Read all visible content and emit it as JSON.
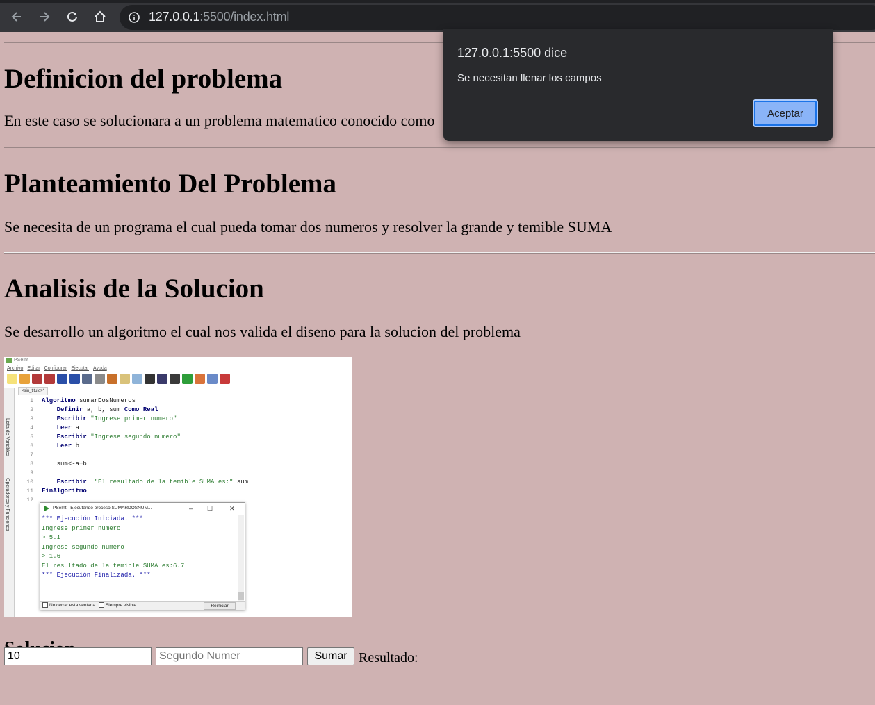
{
  "browser": {
    "url_host": "127.0.0.1",
    "url_rest": ":5500/index.html"
  },
  "sections": [
    {
      "title": "Definicion del problema",
      "text": "En este caso se solucionara a un problema matematico conocido como"
    },
    {
      "title": "Planteamiento Del Problema",
      "text": "Se necesita de un programa el cual pueda tomar dos numeros y resolver la grande y temible SUMA"
    },
    {
      "title": "Analisis de la Solucion",
      "text": "Se desarrollo un algoritmo el cual nos valida el diseno para la solucion del problema"
    }
  ],
  "pseint": {
    "title": "PSeInt",
    "menu": [
      "Archivo",
      "Editar",
      "Configurar",
      "Ejecutar",
      "Ayuda"
    ],
    "tab": "<sin_titulo>*",
    "side_labels": [
      "Lista de Variables",
      "Operadores y Funciones"
    ],
    "code": [
      {
        "n": "1",
        "kw": "Algoritmo",
        "rest": " sumarDosNumeros",
        "str": ""
      },
      {
        "n": "2",
        "kw": "    Definir",
        "rest": " a, b, sum ",
        "kw2": "Como Real",
        "str": ""
      },
      {
        "n": "3",
        "kw": "    Escribir",
        "rest": " ",
        "str": "\"Ingrese primer numero\""
      },
      {
        "n": "4",
        "kw": "    Leer",
        "rest": " a",
        "str": ""
      },
      {
        "n": "5",
        "kw": "    Escribir",
        "rest": " ",
        "str": "\"Ingrese segundo numero\""
      },
      {
        "n": "6",
        "kw": "    Leer",
        "rest": " b",
        "str": ""
      },
      {
        "n": "7",
        "kw": "",
        "rest": "",
        "str": ""
      },
      {
        "n": "8",
        "kw": "",
        "rest": "    sum<-a+b",
        "str": ""
      },
      {
        "n": "9",
        "kw": "",
        "rest": "",
        "str": ""
      },
      {
        "n": "10",
        "kw": "    Escribir",
        "rest": "  ",
        "str": "\"El resultado de la temible SUMA es:\"",
        "rest2": " sum"
      },
      {
        "n": "11",
        "kw": "FinAlgoritmo",
        "rest": "",
        "str": ""
      },
      {
        "n": "12",
        "kw": "",
        "rest": "",
        "str": ""
      }
    ],
    "run_window": {
      "title": "PSeInt - Ejecutando proceso SUMARDOSNUM...",
      "lines": [
        {
          "text": "*** Ejecución Iniciada. ***",
          "tone": "blue"
        },
        {
          "text": "Ingrese primer numero",
          "tone": "green"
        },
        {
          "text": "> 5.1",
          "tone": "green"
        },
        {
          "text": "Ingrese segundo numero",
          "tone": "green"
        },
        {
          "text": "> 1.6",
          "tone": "green"
        },
        {
          "text": "El resultado de la temible SUMA es:6.7",
          "tone": "green"
        },
        {
          "text": "*** Ejecución Finalizada. ***",
          "tone": "blue"
        }
      ],
      "no_cerrar": "No cerrar esta ventana",
      "siempre_visible": "Siempre visible",
      "reiniciar": "Reiniciar"
    }
  },
  "solucion": {
    "heading": "Solucion",
    "input1_value": "10",
    "input2_placeholder": "Segundo Numer",
    "button": "Sumar",
    "result_label": "Resultado:"
  },
  "dialog": {
    "title": "127.0.0.1:5500 dice",
    "message": "Se necesitan llenar los campos",
    "ok": "Aceptar"
  },
  "colors": {
    "page_bg": "#cfb2b2",
    "dialog_bg": "#292a2d",
    "dialog_button": "#8ab4f8"
  }
}
